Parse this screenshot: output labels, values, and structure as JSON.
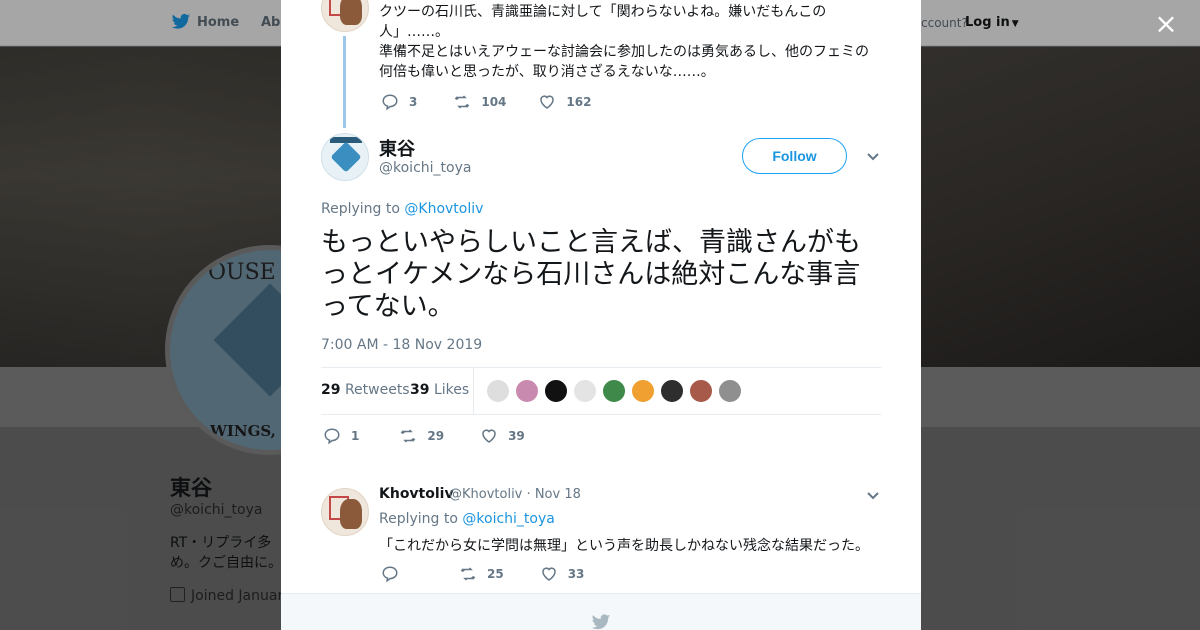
{
  "background_page": {
    "nav": {
      "home": "Home",
      "about": "Abo",
      "account_prompt": "ccount?",
      "login": "Log in"
    },
    "avatar_text": {
      "top": "OUSE TW",
      "bottom": "WINGS, D"
    },
    "profile": {
      "name": "東谷",
      "handle": "@koichi_toya",
      "bio": "RT・リプライ多め。クご自由に。",
      "joined": "Joined Januar"
    }
  },
  "modal": {
    "close": "×",
    "previous_tweet": {
      "text": "クツーの石川氏、青識亜論に対して「関わらないよね。嫌いだもんこの人」……。\n準備不足とはいえアウェーな討論会に参加したのは勇気あるし、他のフェミの何倍も偉いと思ったが、取り消さざるえないな……。",
      "replies": "3",
      "retweets": "104",
      "likes": "162"
    },
    "main_tweet": {
      "author_name": "東谷",
      "author_handle": "@koichi_toya",
      "follow_label": "Follow",
      "replying_prefix": "Replying to",
      "replying_to": "@Khovtoliv",
      "text": "もっといやらしいこと言えば、青識さんがもっとイケメンなら石川さんは絶対こんな事言ってない。",
      "timestamp": "7:00 AM - 18 Nov 2019",
      "retweets_count": "29",
      "retweets_label": "Retweets",
      "likes_count": "39",
      "likes_label": "Likes",
      "likers": [
        {
          "color": "#dedede"
        },
        {
          "color": "#c98ab0"
        },
        {
          "color": "#111111"
        },
        {
          "color": "#e4e4e4"
        },
        {
          "color": "#3f8a4a"
        },
        {
          "color": "#f0a030"
        },
        {
          "color": "#2e2e2e"
        },
        {
          "color": "#a85a4a"
        },
        {
          "color": "#8f8f8f"
        }
      ],
      "replies": "1",
      "retweets": "29",
      "likes": "39"
    },
    "reply_tweet": {
      "author_name": "Khovtoliv",
      "author_handle": "@Khovtoliv",
      "date": "Nov 18",
      "replying_prefix": "Replying to",
      "replying_to": "@koichi_toya",
      "text": "「これだから女に学問は無理」という声を助長しかねない残念な結果だった。",
      "replies": "",
      "retweets": "25",
      "likes": "33"
    }
  },
  "colors": {
    "accent": "#1da1f2",
    "link": "#1b95e0",
    "text": "#14171a",
    "muted": "#657786"
  }
}
